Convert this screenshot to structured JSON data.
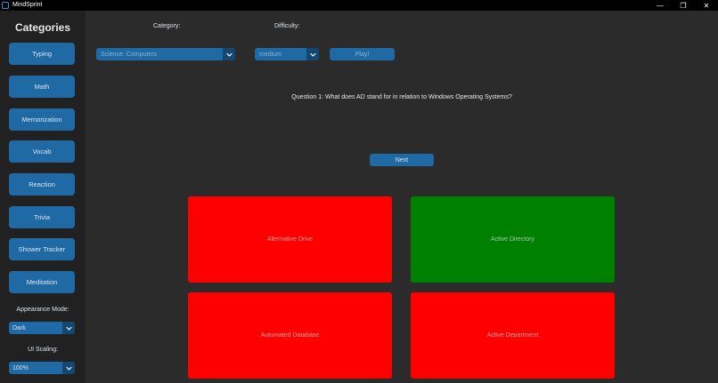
{
  "window": {
    "title": "MindSprint"
  },
  "sidebar": {
    "heading": "Categories",
    "items": [
      {
        "label": "Typing"
      },
      {
        "label": "Math"
      },
      {
        "label": "Memorization"
      },
      {
        "label": "Vocab"
      },
      {
        "label": "Reaction"
      },
      {
        "label": "Trivia"
      },
      {
        "label": "Shower Tracker"
      },
      {
        "label": "Meditation"
      }
    ],
    "appearance": {
      "label": "Appearance Mode:",
      "value": "Dark"
    },
    "scaling": {
      "label": "UI Scaling:",
      "value": "100%"
    }
  },
  "controls": {
    "category_label": "Category:",
    "category_value": "Science: Computers",
    "difficulty_label": "Difficulty:",
    "difficulty_value": "medium",
    "play_label": "Play!"
  },
  "quiz": {
    "question": "Question 1: What does AD stand for in relation to Windows Operating Systems?",
    "next_label": "Next",
    "answers": [
      {
        "label": "Alternative Drive",
        "status": "wrong"
      },
      {
        "label": "Active Directory",
        "status": "correct"
      },
      {
        "label": "Automated Database",
        "status": "wrong"
      },
      {
        "label": "Active Department",
        "status": "wrong"
      }
    ]
  },
  "colors": {
    "button": "#1f6aa5",
    "button_dark": "#144870",
    "wrong": "#ff0000",
    "correct": "#008000",
    "background": "#2b2b2b",
    "sidebar": "#212121"
  }
}
